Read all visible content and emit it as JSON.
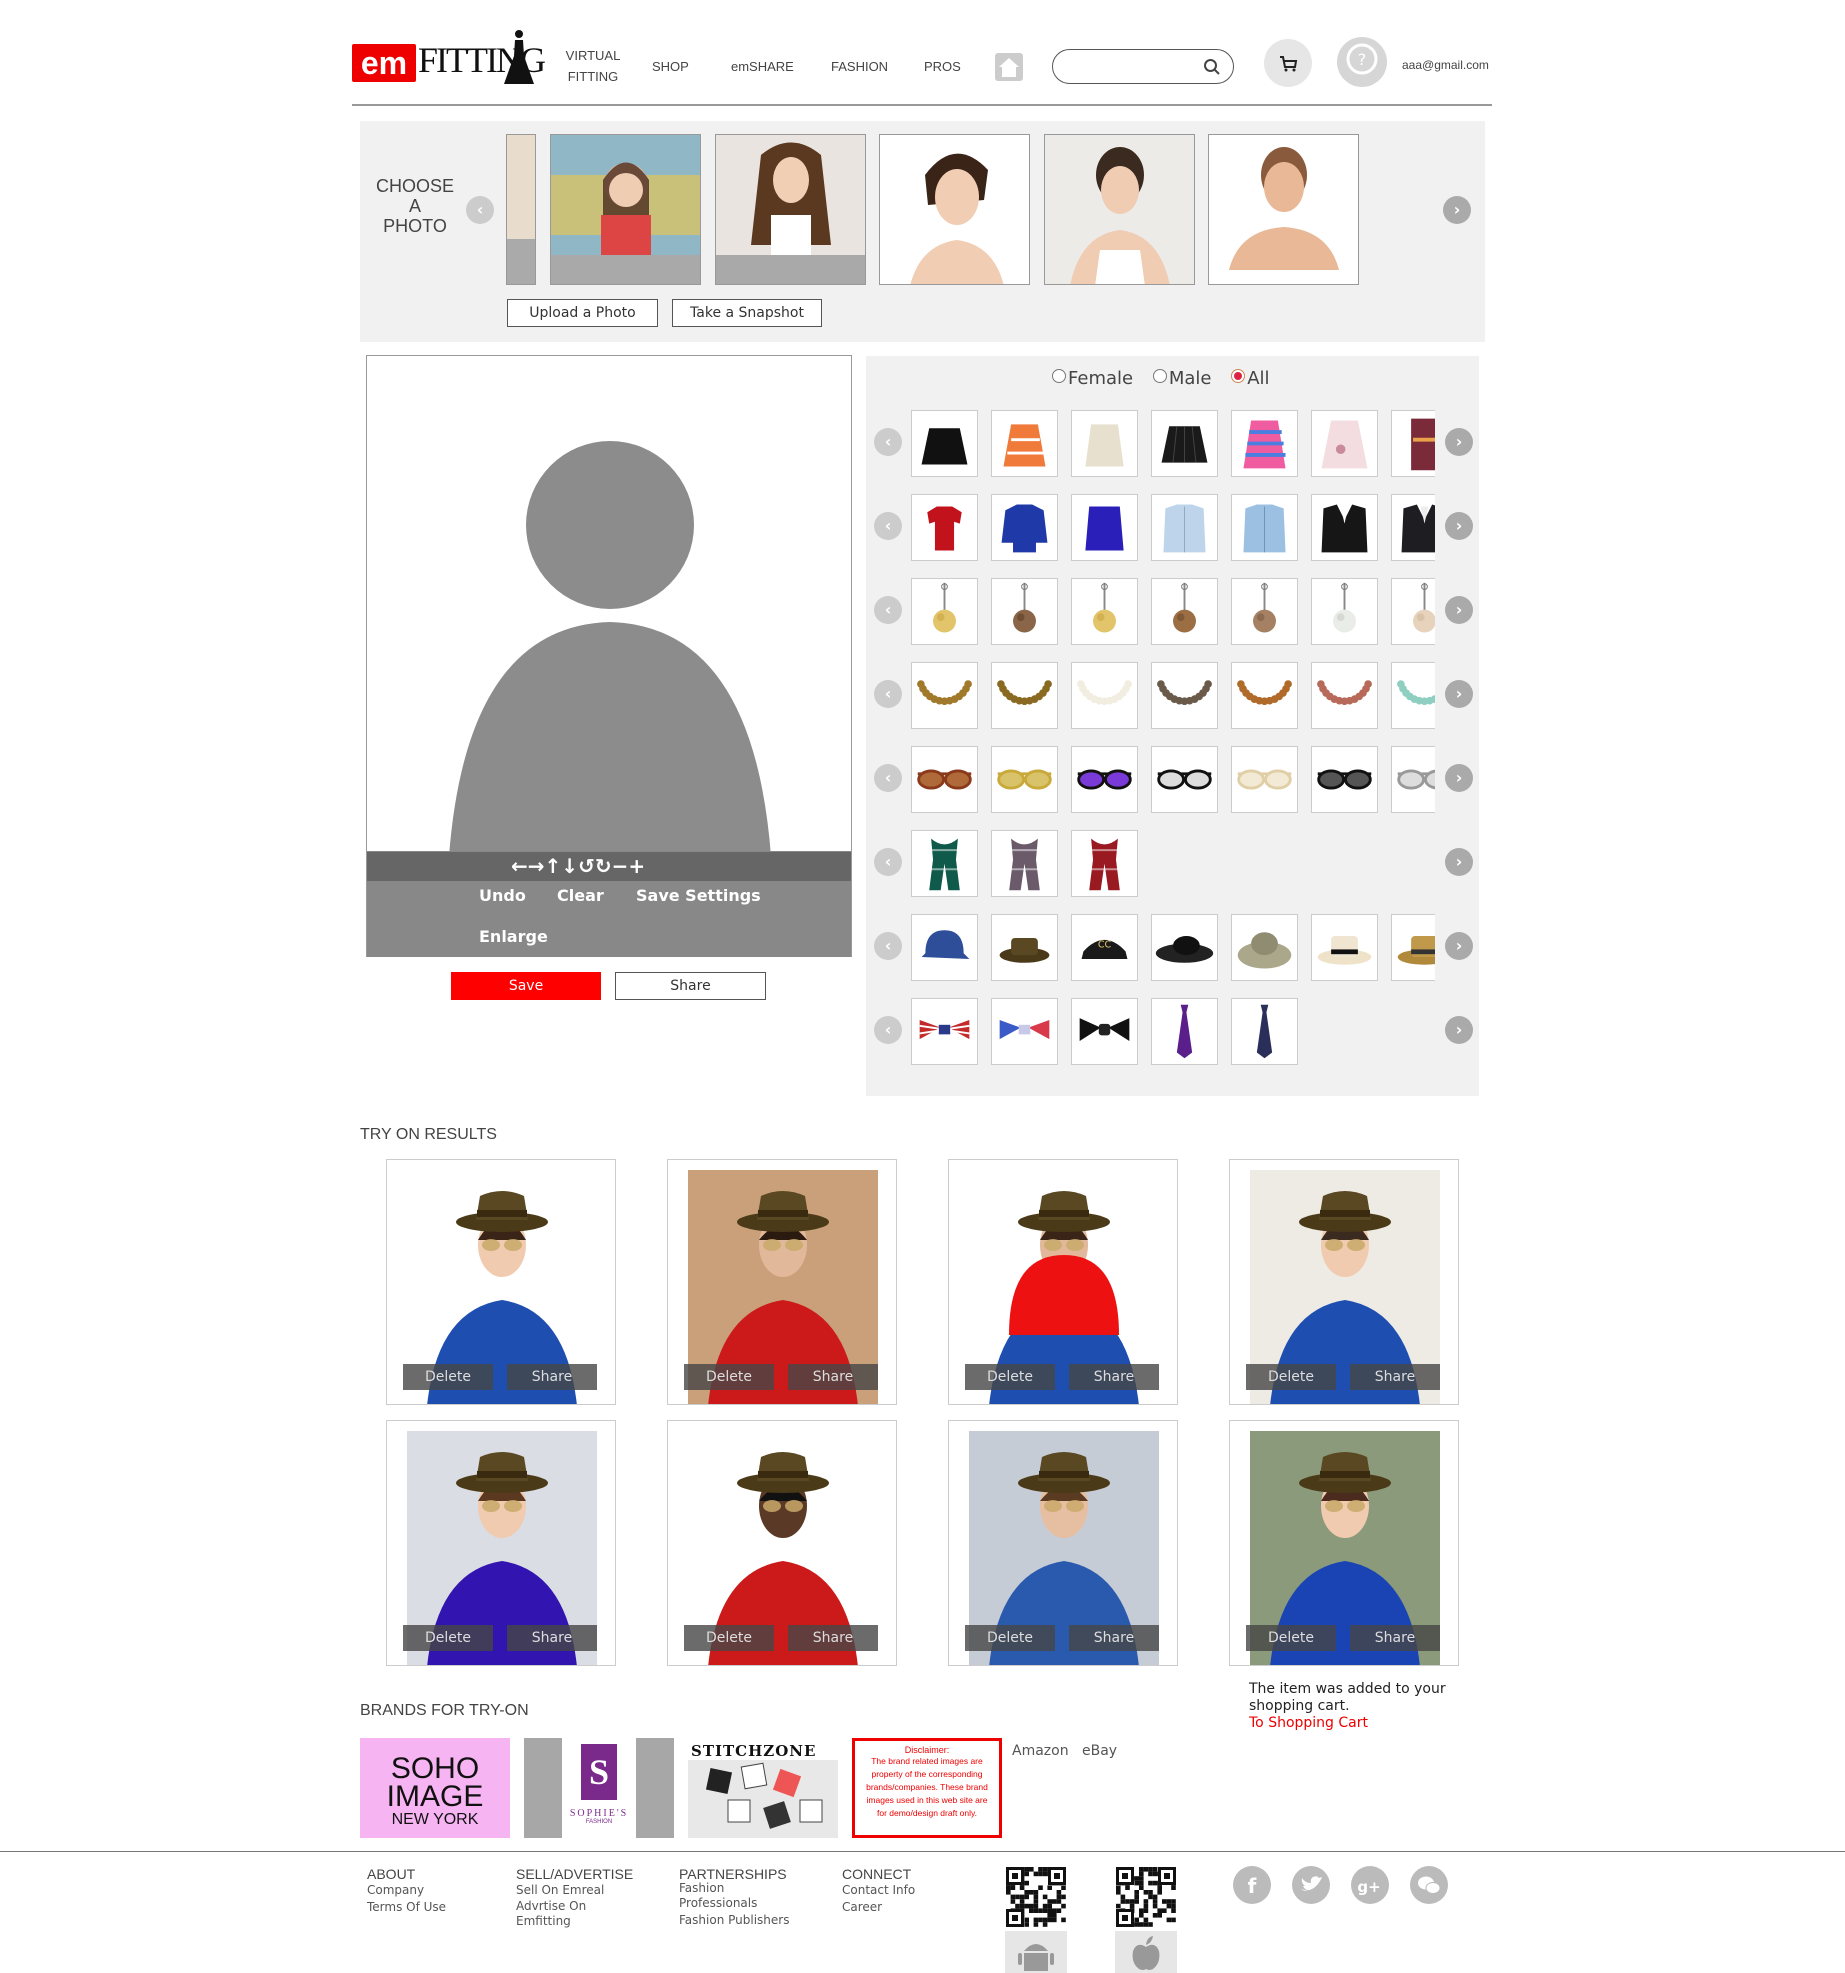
{
  "header": {
    "logo": {
      "em": "em",
      "fitting": "FITTING"
    },
    "nav": [
      {
        "label": "VIRTUAL"
      },
      {
        "label": "FITTING"
      },
      {
        "label": "SHOP"
      },
      {
        "label": "emSHARE"
      },
      {
        "label": "FASHION"
      },
      {
        "label": "PROS"
      }
    ],
    "search": {
      "placeholder": ""
    },
    "user_email": "aaa@gmail.com"
  },
  "photo_chooser": {
    "label_lines": [
      "CHOOSE",
      "A",
      "PHOTO"
    ],
    "upload_label": "Upload a Photo",
    "snapshot_label": "Take a Snapshot"
  },
  "editor": {
    "controls": [
      "←",
      "→",
      "↑",
      "↓",
      "↺",
      "↻",
      "−",
      "+"
    ],
    "undo_label": "Undo",
    "clear_label": "Clear",
    "save_settings_label": "Save Settings",
    "enlarge_label": "Enlarge",
    "save_label": "Save",
    "share_label": "Share"
  },
  "catalog": {
    "filters": [
      {
        "label": "Female",
        "selected": false
      },
      {
        "label": "Male",
        "selected": false
      },
      {
        "label": "All",
        "selected": true
      }
    ],
    "rows": [
      {
        "category": "skirts",
        "count": 7
      },
      {
        "category": "tops",
        "count": 7
      },
      {
        "category": "earrings",
        "count": 7
      },
      {
        "category": "necklaces",
        "count": 7
      },
      {
        "category": "sunglasses",
        "count": 7
      },
      {
        "category": "scarves",
        "count": 3
      },
      {
        "category": "hats",
        "count": 7
      },
      {
        "category": "ties",
        "count": 5
      }
    ]
  },
  "results": {
    "title": "TRY ON RESULTS",
    "delete_label": "Delete",
    "share_label": "Share",
    "cart_message": "The item was added to your shopping cart.",
    "cart_link": "To Shopping Cart"
  },
  "brands": {
    "title": "BRANDS FOR TRY-ON",
    "soho": [
      "SOHO",
      "IMAGE",
      "NEW YORK"
    ],
    "sophies": "SOPHIE'S",
    "sophies_sub": "FASHION",
    "stitchzone": "STITCHZONE",
    "disclaimer_title": "Disclaimer:",
    "disclaimer_body": "The brand related images are property of the corresponding brands/companies. These brand images used in this web site are for demo/design draft only.",
    "links": [
      "Amazon",
      "eBay"
    ]
  },
  "footer": {
    "columns": [
      {
        "head": "ABOUT",
        "links": [
          "Company",
          "Terms Of Use"
        ]
      },
      {
        "head": "SELL/ADVERTISE",
        "links": [
          "Sell On Emreal",
          "Advrtise On",
          "Emfitting"
        ]
      },
      {
        "head": "PARTNERSHIPS",
        "links": [
          "Fashion",
          "Professionals",
          "Fashion Publishers"
        ]
      },
      {
        "head": "CONNECT",
        "links": [
          "Contact Info",
          "Career"
        ]
      }
    ],
    "social": [
      "facebook-icon",
      "twitter-icon",
      "google-plus-icon",
      "wechat-icon"
    ]
  },
  "colors": {
    "accent": "#ff0000",
    "panel": "#f1f1f1",
    "silhouette": "#8c8c8c"
  }
}
